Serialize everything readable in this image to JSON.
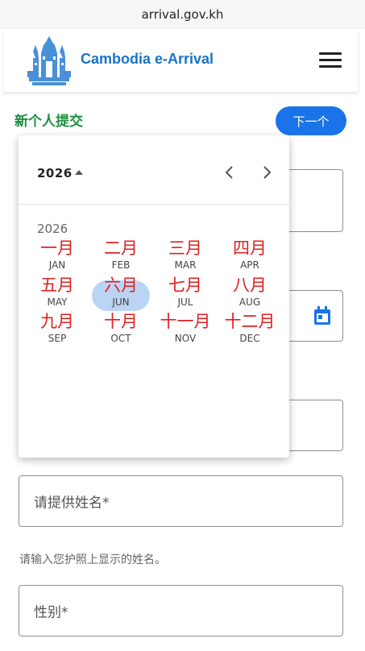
{
  "browser": {
    "url": "arrival.gov.kh"
  },
  "header": {
    "brand": "Cambodia e-Arrival"
  },
  "page": {
    "subtitle": "新个人提交",
    "next_label": "下一个"
  },
  "form": {
    "given_name_label": "请提供姓名*",
    "name_helper": "请输入您护照上显示的姓名。",
    "gender_label": "性别*"
  },
  "datepicker": {
    "header_year": "2026",
    "grid_year": "2026",
    "selected_month": "JUN",
    "months": [
      {
        "zh": "一月",
        "en": "JAN"
      },
      {
        "zh": "二月",
        "en": "FEB"
      },
      {
        "zh": "三月",
        "en": "MAR"
      },
      {
        "zh": "四月",
        "en": "APR"
      },
      {
        "zh": "五月",
        "en": "MAY"
      },
      {
        "zh": "六月",
        "en": "JUN"
      },
      {
        "zh": "七月",
        "en": "JUL"
      },
      {
        "zh": "八月",
        "en": "AUG"
      },
      {
        "zh": "九月",
        "en": "SEP"
      },
      {
        "zh": "十月",
        "en": "OCT"
      },
      {
        "zh": "十一月",
        "en": "NOV"
      },
      {
        "zh": "十二月",
        "en": "DEC"
      }
    ]
  },
  "colors": {
    "brand": "#1a73c8",
    "button": "#1a73e8",
    "subtitle": "#1e8e3e",
    "month_zh": "#e02020",
    "selection": "#bcd4f4"
  }
}
